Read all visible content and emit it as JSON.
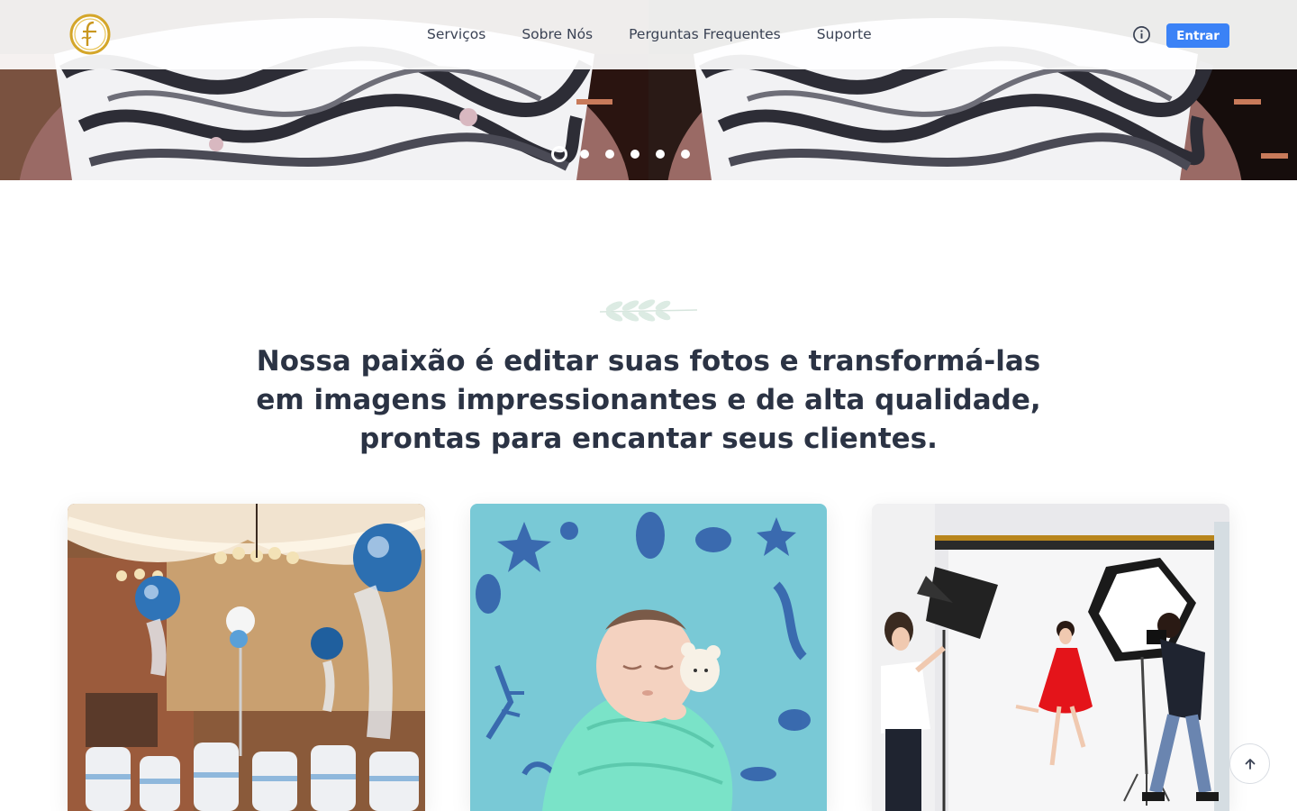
{
  "header": {
    "logo_alt": "F logo",
    "nav": [
      "Serviços",
      "Sobre Nós",
      "Perguntas Frequentes",
      "Suporte"
    ],
    "info_icon": "info-circle-icon",
    "login_label": "Entrar",
    "accent": "#3b82f6"
  },
  "hero": {
    "dots_total": 6,
    "active_dot": 1
  },
  "section": {
    "decoration_icon": "leaf-branch-icon",
    "headline": "Nossa paixão é editar suas fotos e transformá-las em imagens impressionantes e de alta qualidade, prontas para encantar seus clientes."
  },
  "cards": [
    {
      "image": "event-hall-balloons"
    },
    {
      "image": "newborn-baby-sea-blanket"
    },
    {
      "image": "photo-studio-shoot"
    }
  ],
  "scroll_top_icon": "arrow-up-icon"
}
